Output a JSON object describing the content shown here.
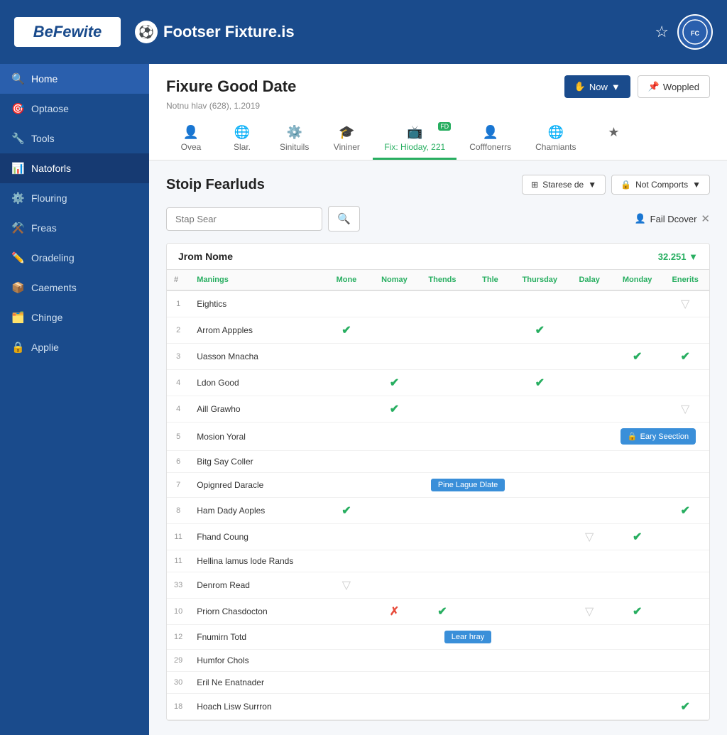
{
  "app": {
    "logo": "BeFewite",
    "site_name": "Footser Fixture.is"
  },
  "header": {
    "page_title": "Fixure Good Date",
    "page_subtitle": "Notnu hlav (628), 1.2019",
    "btn_now": "Now",
    "btn_woppled": "Woppled"
  },
  "tabs": [
    {
      "id": "ovea",
      "label": "Ovea",
      "icon": "👤"
    },
    {
      "id": "slar",
      "label": "Slar.",
      "icon": "🌐"
    },
    {
      "id": "sinituils",
      "label": "Sinituils",
      "icon": "⚙️"
    },
    {
      "id": "vininer",
      "label": "Vininer",
      "icon": "🎓"
    },
    {
      "id": "fix-hioday",
      "label": "Fix: Hioday, 221",
      "icon": "📺",
      "active": true,
      "badge": "FD"
    },
    {
      "id": "cofffonerrs",
      "label": "Cofffonerrs",
      "icon": "👤"
    },
    {
      "id": "chamiants",
      "label": "Chamiants",
      "icon": "🌐"
    },
    {
      "id": "star",
      "label": "★",
      "icon": "★"
    }
  ],
  "sidebar": {
    "items": [
      {
        "id": "home",
        "label": "Home",
        "icon": "🔍"
      },
      {
        "id": "optaose",
        "label": "Optaose",
        "icon": "🎯"
      },
      {
        "id": "tools",
        "label": "Tools",
        "icon": "🔧"
      },
      {
        "id": "natoforls",
        "label": "Natoforls",
        "icon": "📊",
        "active": true
      },
      {
        "id": "flouring",
        "label": "Flouring",
        "icon": "⚙️"
      },
      {
        "id": "freas",
        "label": "Freas",
        "icon": "⚒️"
      },
      {
        "id": "oradeling",
        "label": "Oradeling",
        "icon": "✏️"
      },
      {
        "id": "caements",
        "label": "Caements",
        "icon": "📦"
      },
      {
        "id": "chinge",
        "label": "Chinge",
        "icon": "🗂️"
      },
      {
        "id": "applie",
        "label": "Applie",
        "icon": "🔒"
      }
    ]
  },
  "section": {
    "title": "Stoip Fearluds",
    "filter1": "Starese de",
    "filter2": "Not Comports",
    "search_placeholder": "Stap Sear",
    "user_filter_label": "Fail Dcover",
    "table_title": "Jrom Nome",
    "table_count": "32.251"
  },
  "table": {
    "columns": [
      "#",
      "Manings",
      "Mone",
      "Nomay",
      "Thends",
      "Thle",
      "Thursday",
      "Dalay",
      "Monday",
      "Enerits"
    ],
    "rows": [
      {
        "num": "1",
        "name": "Eightics",
        "mone": "",
        "nomay": "",
        "thends": "",
        "thle": "",
        "thursday": "",
        "dalay": "",
        "monday": "",
        "enerits": "gray"
      },
      {
        "num": "2",
        "name": "Arrom Appples",
        "mone": "check",
        "nomay": "",
        "thends": "",
        "thle": "",
        "thursday": "check",
        "dalay": "",
        "monday": "",
        "enerits": ""
      },
      {
        "num": "3",
        "name": "Uasson Mnacha",
        "mone": "",
        "nomay": "",
        "thends": "",
        "thle": "",
        "thursday": "",
        "dalay": "",
        "monday": "check",
        "enerits": "check"
      },
      {
        "num": "4",
        "name": "Ldon Good",
        "mone": "",
        "nomay": "check",
        "thends": "",
        "thle": "",
        "thursday": "check",
        "dalay": "",
        "monday": "",
        "enerits": ""
      },
      {
        "num": "4",
        "name": "Aill Grawho",
        "mone": "",
        "nomay": "check",
        "thends": "",
        "thle": "",
        "thursday": "",
        "dalay": "",
        "monday": "",
        "enerits": "gray"
      },
      {
        "num": "5",
        "name": "Mosion Yoral",
        "mone": "",
        "nomay": "",
        "thends": "",
        "thle": "",
        "thursday": "",
        "dalay": "",
        "monday": "",
        "enerits": "",
        "special": "early"
      },
      {
        "num": "6",
        "name": "Bitg Say Coller",
        "mone": "",
        "nomay": "",
        "thends": "",
        "thle": "",
        "thursday": "",
        "dalay": "",
        "monday": "",
        "enerits": ""
      },
      {
        "num": "7",
        "name": "Opignred Daracle",
        "mone": "",
        "nomay": "",
        "thends": "span",
        "thle": "span",
        "thursday": "span",
        "dalay": "span",
        "monday": "",
        "enerits": "",
        "span_label": "Pine Lague Dlate"
      },
      {
        "num": "8",
        "name": "Ham Dady Aoples",
        "mone": "check",
        "nomay": "",
        "thends": "",
        "thle": "",
        "thursday": "",
        "dalay": "",
        "monday": "",
        "enerits": "check"
      },
      {
        "num": "11",
        "name": "Fhand Coung",
        "mone": "",
        "nomay": "",
        "thends": "",
        "thle": "",
        "thursday": "",
        "dalay": "gray",
        "monday": "check",
        "enerits": ""
      },
      {
        "num": "11",
        "name": "Hellina lamus lode Rands",
        "mone": "",
        "nomay": "",
        "thends": "",
        "thle": "",
        "thursday": "",
        "dalay": "",
        "monday": "",
        "enerits": ""
      },
      {
        "num": "33",
        "name": "Denrom Read",
        "mone": "gray",
        "nomay": "",
        "thends": "",
        "thle": "",
        "thursday": "",
        "dalay": "",
        "monday": "",
        "enerits": ""
      },
      {
        "num": "10",
        "name": "Priorn Chasdocton",
        "mone": "",
        "nomay": "red",
        "thends": "check",
        "thle": "",
        "thursday": "",
        "dalay": "gray",
        "monday": "check",
        "enerits": ""
      },
      {
        "num": "12",
        "name": "Fnumirn Totd",
        "mone": "",
        "nomay": "",
        "thends": "span2",
        "thle": "span2",
        "thursday": "span2",
        "dalay": "span2",
        "monday": "",
        "enerits": "",
        "span2_label": "Lear hray"
      },
      {
        "num": "29",
        "name": "Humfor Chols",
        "mone": "",
        "nomay": "",
        "thends": "",
        "thle": "",
        "thursday": "",
        "dalay": "",
        "monday": "",
        "enerits": ""
      },
      {
        "num": "30",
        "name": "Eril Ne Enatnader",
        "mone": "",
        "nomay": "",
        "thends": "",
        "thle": "",
        "thursday": "",
        "dalay": "",
        "monday": "",
        "enerits": ""
      },
      {
        "num": "18",
        "name": "Hoach Lisw Surrron",
        "mone": "",
        "nomay": "",
        "thends": "",
        "thle": "",
        "thursday": "",
        "dalay": "",
        "monday": "",
        "enerits": "check"
      }
    ]
  },
  "buttons": {
    "early_section": "Eary Seection"
  }
}
